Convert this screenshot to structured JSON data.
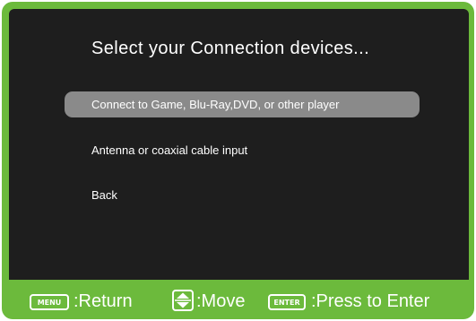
{
  "menu": {
    "title": "Select your Connection devices...",
    "items": [
      {
        "label": "Connect to Game, Blu-Ray,DVD, or other player",
        "selected": true
      },
      {
        "label": "Antenna or coaxial cable input",
        "selected": false
      },
      {
        "label": "Back",
        "selected": false
      }
    ]
  },
  "footer": {
    "menu_key": "MENU",
    "return_label": ":Return",
    "move_icon": "up-down-arrows-icon",
    "move_label": ":Move",
    "enter_key": "ENTER",
    "enter_label": ":Press to Enter"
  },
  "colors": {
    "frame_green": "#6cba3c",
    "screen_bg": "#1e1e1e",
    "selected_bg": "#8a8a8a",
    "text": "#ffffff"
  }
}
